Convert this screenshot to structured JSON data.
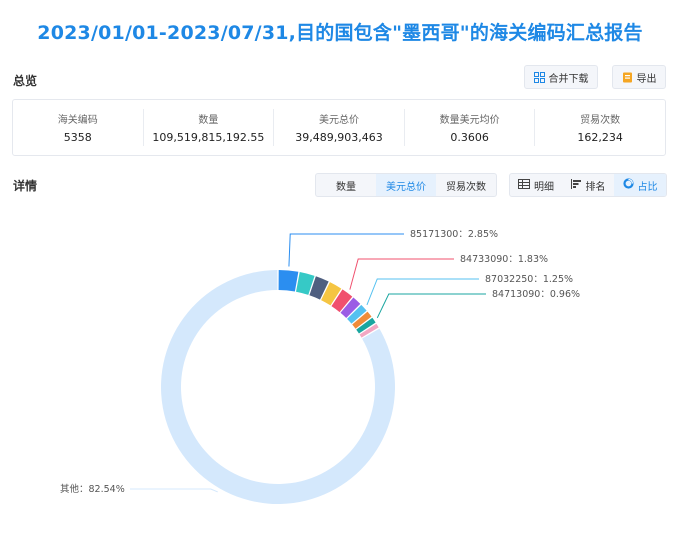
{
  "title": "2023/01/01-2023/07/31,目的国包含\"墨西哥\"的海关编码汇总报告",
  "overview": {
    "label": "总览",
    "merge_download": "合并下载",
    "export": "导出"
  },
  "summary": [
    {
      "label": "海关编码",
      "value": "5358"
    },
    {
      "label": "数量",
      "value": "109,519,815,192.55"
    },
    {
      "label": "美元总价",
      "value": "39,489,903,463"
    },
    {
      "label": "数量美元均价",
      "value": "0.3606"
    },
    {
      "label": "贸易次数",
      "value": "162,234"
    }
  ],
  "detail": {
    "label": "详情",
    "metric_tabs": [
      {
        "label": "数量",
        "active": false
      },
      {
        "label": "美元总价",
        "active": true
      },
      {
        "label": "贸易次数",
        "active": false
      }
    ],
    "view_tabs": [
      {
        "label": "明细",
        "icon": "table-icon",
        "active": false
      },
      {
        "label": "排名",
        "icon": "bar-rank-icon",
        "active": false
      },
      {
        "label": "占比",
        "icon": "pie-icon",
        "active": true
      }
    ]
  },
  "colors": {
    "accent": "#1e88e5",
    "others": "#d4e8fc"
  },
  "chart_data": {
    "type": "pie",
    "variant": "donut",
    "slices": [
      {
        "name": "85171300",
        "value": 2.85,
        "color": "#2b8ef0",
        "label": "85171300：2.85%"
      },
      {
        "name": "",
        "value": 2.25,
        "color": "#36c9c6",
        "label": ""
      },
      {
        "name": "",
        "value": 2.05,
        "color": "#4f5f80",
        "label": ""
      },
      {
        "name": "",
        "value": 1.95,
        "color": "#f5c542",
        "label": ""
      },
      {
        "name": "84733090",
        "value": 1.83,
        "color": "#f0506e",
        "label": "84733090：1.83%"
      },
      {
        "name": "",
        "value": 1.45,
        "color": "#9b5de5",
        "label": ""
      },
      {
        "name": "87032250",
        "value": 1.25,
        "color": "#55c1f0",
        "label": "87032250：1.25%"
      },
      {
        "name": "",
        "value": 1.05,
        "color": "#f08c3a",
        "label": ""
      },
      {
        "name": "84713090",
        "value": 0.96,
        "color": "#1aa6a0",
        "label": "84713090：0.96%"
      },
      {
        "name": "",
        "value": 0.78,
        "color": "#f2a7c3",
        "label": ""
      },
      {
        "name": "其他",
        "value": 82.54,
        "color": "#d4e8fc",
        "label": "其他：82.54%"
      }
    ]
  }
}
